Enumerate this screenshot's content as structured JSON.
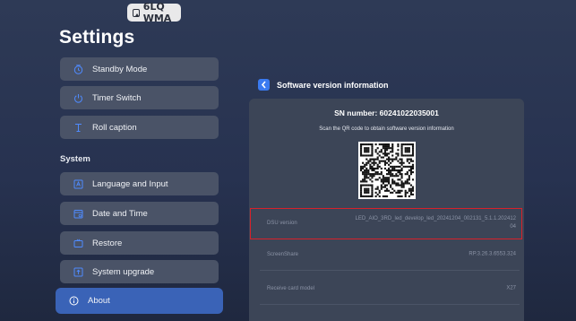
{
  "badge": {
    "label": "6LQ WMA"
  },
  "page": {
    "title": "Settings"
  },
  "menu": {
    "items": [
      {
        "label": "Standby Mode"
      },
      {
        "label": "Timer Switch"
      },
      {
        "label": "Roll caption"
      }
    ],
    "section_label": "System",
    "system_items": [
      {
        "label": "Language and Input"
      },
      {
        "label": "Date and Time"
      },
      {
        "label": "Restore"
      },
      {
        "label": "System upgrade"
      },
      {
        "label": "About"
      }
    ]
  },
  "panel": {
    "title": "Software version information",
    "sn": "SN number: 60241022035001",
    "scan_text": "Scan the QR code to obtain software version information",
    "rows": [
      {
        "key": "DSU version",
        "value_line1": "LED_AIO_3RD_led_develop_led_20241204_002131_5.1.1.202412",
        "value_line2": "04"
      },
      {
        "key": "ScreenShare",
        "value": "RP.3.26.3.6553.324"
      },
      {
        "key": "Receive card model",
        "value": "X27"
      }
    ]
  },
  "colors": {
    "active": "#3a63b7",
    "highlight": "#d8212a",
    "back_button": "#3a7af0"
  }
}
